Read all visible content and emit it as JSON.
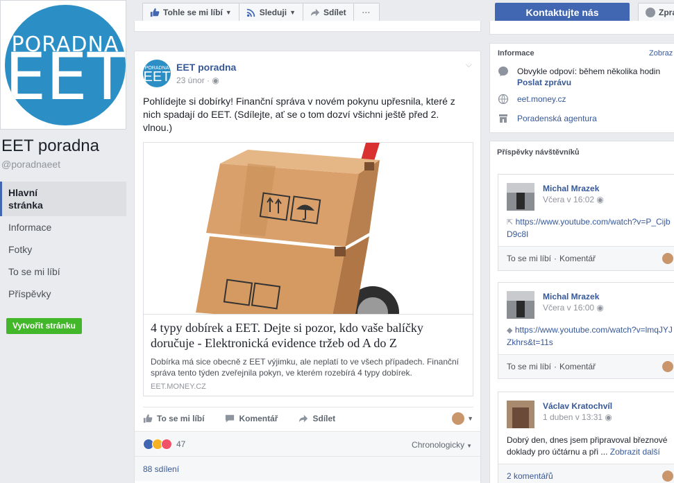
{
  "profile": {
    "logo_top": "PORADNA",
    "logo_main": "EET",
    "name": "EET poradna",
    "handle": "@poradnaeet"
  },
  "nav": {
    "items": [
      "Hlavní stránka",
      "Informace",
      "Fotky",
      "To se mi líbí",
      "Příspěvky"
    ],
    "create_page": "Vytvořit stránku"
  },
  "actionbar": {
    "like": "Tohle se mi líbí",
    "follow": "Sleduji",
    "share": "Sdílet",
    "more": "···"
  },
  "post": {
    "author": "EET poradna",
    "date": "23 únor · ",
    "avatar_top": "PORADNA",
    "avatar_main": "EET",
    "text": "Pohlídejte si dobírky! Finanční správa v novém pokynu upřesnila, které z nich spadají do EET. (Sdílejte, ať se o tom dozví všichni ještě před 2. vlnou.)",
    "link_title": "4 typy dobírek a EET. Dejte si pozor, kdo vaše balíčky doručuje - Elektronická evidence tržeb od A do Z",
    "link_desc": "Dobírka má sice obecně z EET výjimku, ale neplatí to ve všech případech. Finanční správa tento týden zveřejnila pokyn, ve kterém rozebírá 4 typy dobírek.",
    "link_domain": "EET.MONEY.CZ",
    "like_label": "To se mi líbí",
    "comment_label": "Komentář",
    "share_label": "Sdílet",
    "reactions_count": "47",
    "sort_label": "Chronologicky",
    "shares": "88 sdílení"
  },
  "right": {
    "contact": "Kontaktujte nás",
    "message": "Zpra",
    "info_title": "Informace",
    "info_edit": "Zobraz",
    "response": "Obvykle odpoví: během několika hodin",
    "send_message": "Poslat zprávu",
    "website": "eet.money.cz",
    "category": "Poradenská agentura",
    "visitors_title": "Příspěvky návštěvníků"
  },
  "visitor_posts": [
    {
      "name": "Michal Mrazek",
      "time": "Včera v 16:02",
      "text": "https://www.youtube.com/watch?v=P_CijbD9c8I",
      "like": "To se mi líbí",
      "comment": "Komentář"
    },
    {
      "name": "Michal Mrazek",
      "time": "Včera v 16:00",
      "text": "https://www.youtube.com/watch?v=lmqJYJZkhrs&t=11s",
      "like": "To se mi líbí",
      "comment": "Komentář"
    },
    {
      "name": "Václav Kratochvíl",
      "time": "1 duben v 13:31",
      "text": "Dobrý den, dnes jsem připravoval březnové doklady pro účtárnu a při ...",
      "more": "Zobrazit další",
      "comments": "2 komentářů"
    }
  ],
  "colors": {
    "brand_blue": "#4267b2",
    "link": "#365899",
    "green": "#42b72a",
    "logo_blue": "#2b8fc5"
  }
}
